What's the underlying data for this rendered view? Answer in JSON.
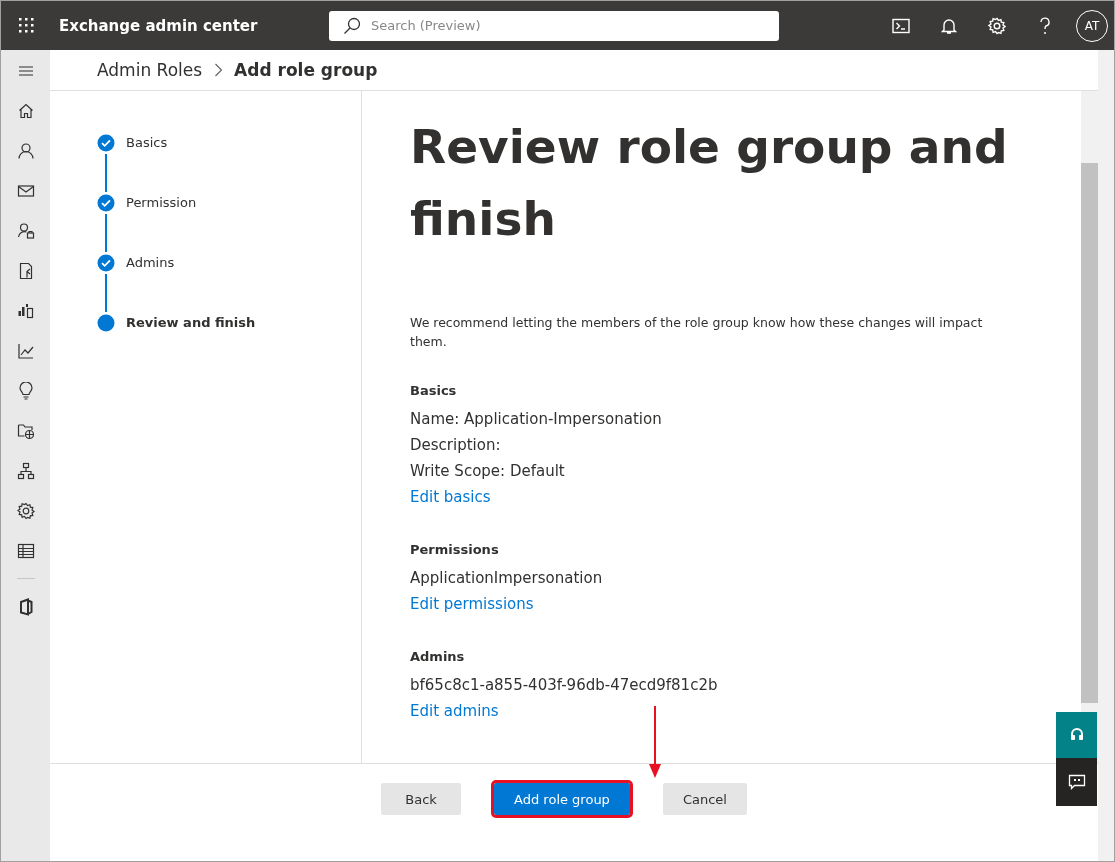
{
  "app": {
    "title": "Exchange admin center",
    "search": {
      "placeholder": "Search (Preview)"
    },
    "avatar": "AT"
  },
  "breadcrumb": [
    {
      "label": "Admin Roles",
      "current": false
    },
    {
      "label": "Add role group",
      "current": true
    }
  ],
  "steps": [
    {
      "label": "Basics",
      "completed": true,
      "current": false
    },
    {
      "label": "Permission",
      "completed": true,
      "current": false
    },
    {
      "label": "Admins",
      "completed": true,
      "current": false
    },
    {
      "label": "Review and finish",
      "completed": false,
      "current": true
    }
  ],
  "heading": "Review role group and finish",
  "intro": "We recommend letting the members of the role group know how these changes will impact them.",
  "sections": [
    {
      "title": "Basics",
      "lines": [
        "Name: Application-Impersonation",
        "Description:",
        "Write Scope: Default"
      ],
      "link": "Edit basics"
    },
    {
      "title": "Permissions",
      "lines": [
        "ApplicationImpersonation"
      ],
      "link": "Edit permissions"
    },
    {
      "title": "Admins",
      "lines": [
        "bf65c8c1-a855-403f-96db-47ecd9f81c2b"
      ],
      "link": "Edit admins"
    }
  ],
  "buttons": [
    {
      "label": "Back",
      "kind": "secondary",
      "highlighted": false
    },
    {
      "label": "Add role group",
      "kind": "primary",
      "highlighted": true
    },
    {
      "label": "Cancel",
      "kind": "secondary",
      "highlighted": false
    }
  ]
}
